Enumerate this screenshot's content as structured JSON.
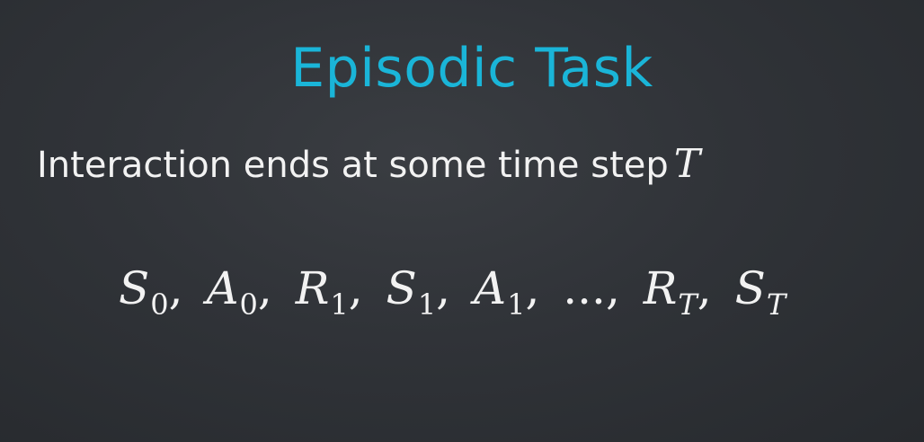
{
  "slide": {
    "title": "Episodic Task",
    "statement": "Interaction ends at some time step",
    "statement_variable": "T",
    "sequence": [
      {
        "symbol": "S",
        "sub": "0",
        "sep": ","
      },
      {
        "symbol": "A",
        "sub": "0",
        "sep": ","
      },
      {
        "symbol": "R",
        "sub": "1",
        "sep": ","
      },
      {
        "symbol": "S",
        "sub": "1",
        "sep": ","
      },
      {
        "symbol": "A",
        "sub": "1",
        "sep": ","
      },
      {
        "symbol": "...",
        "sub": "",
        "sep": ","
      },
      {
        "symbol": "R",
        "sub": "T",
        "sep": ","
      },
      {
        "symbol": "S",
        "sub": "T",
        "sep": ""
      }
    ],
    "colors": {
      "title": "#1ab5d8",
      "text": "#f2f2f2",
      "background": "#303338"
    }
  }
}
